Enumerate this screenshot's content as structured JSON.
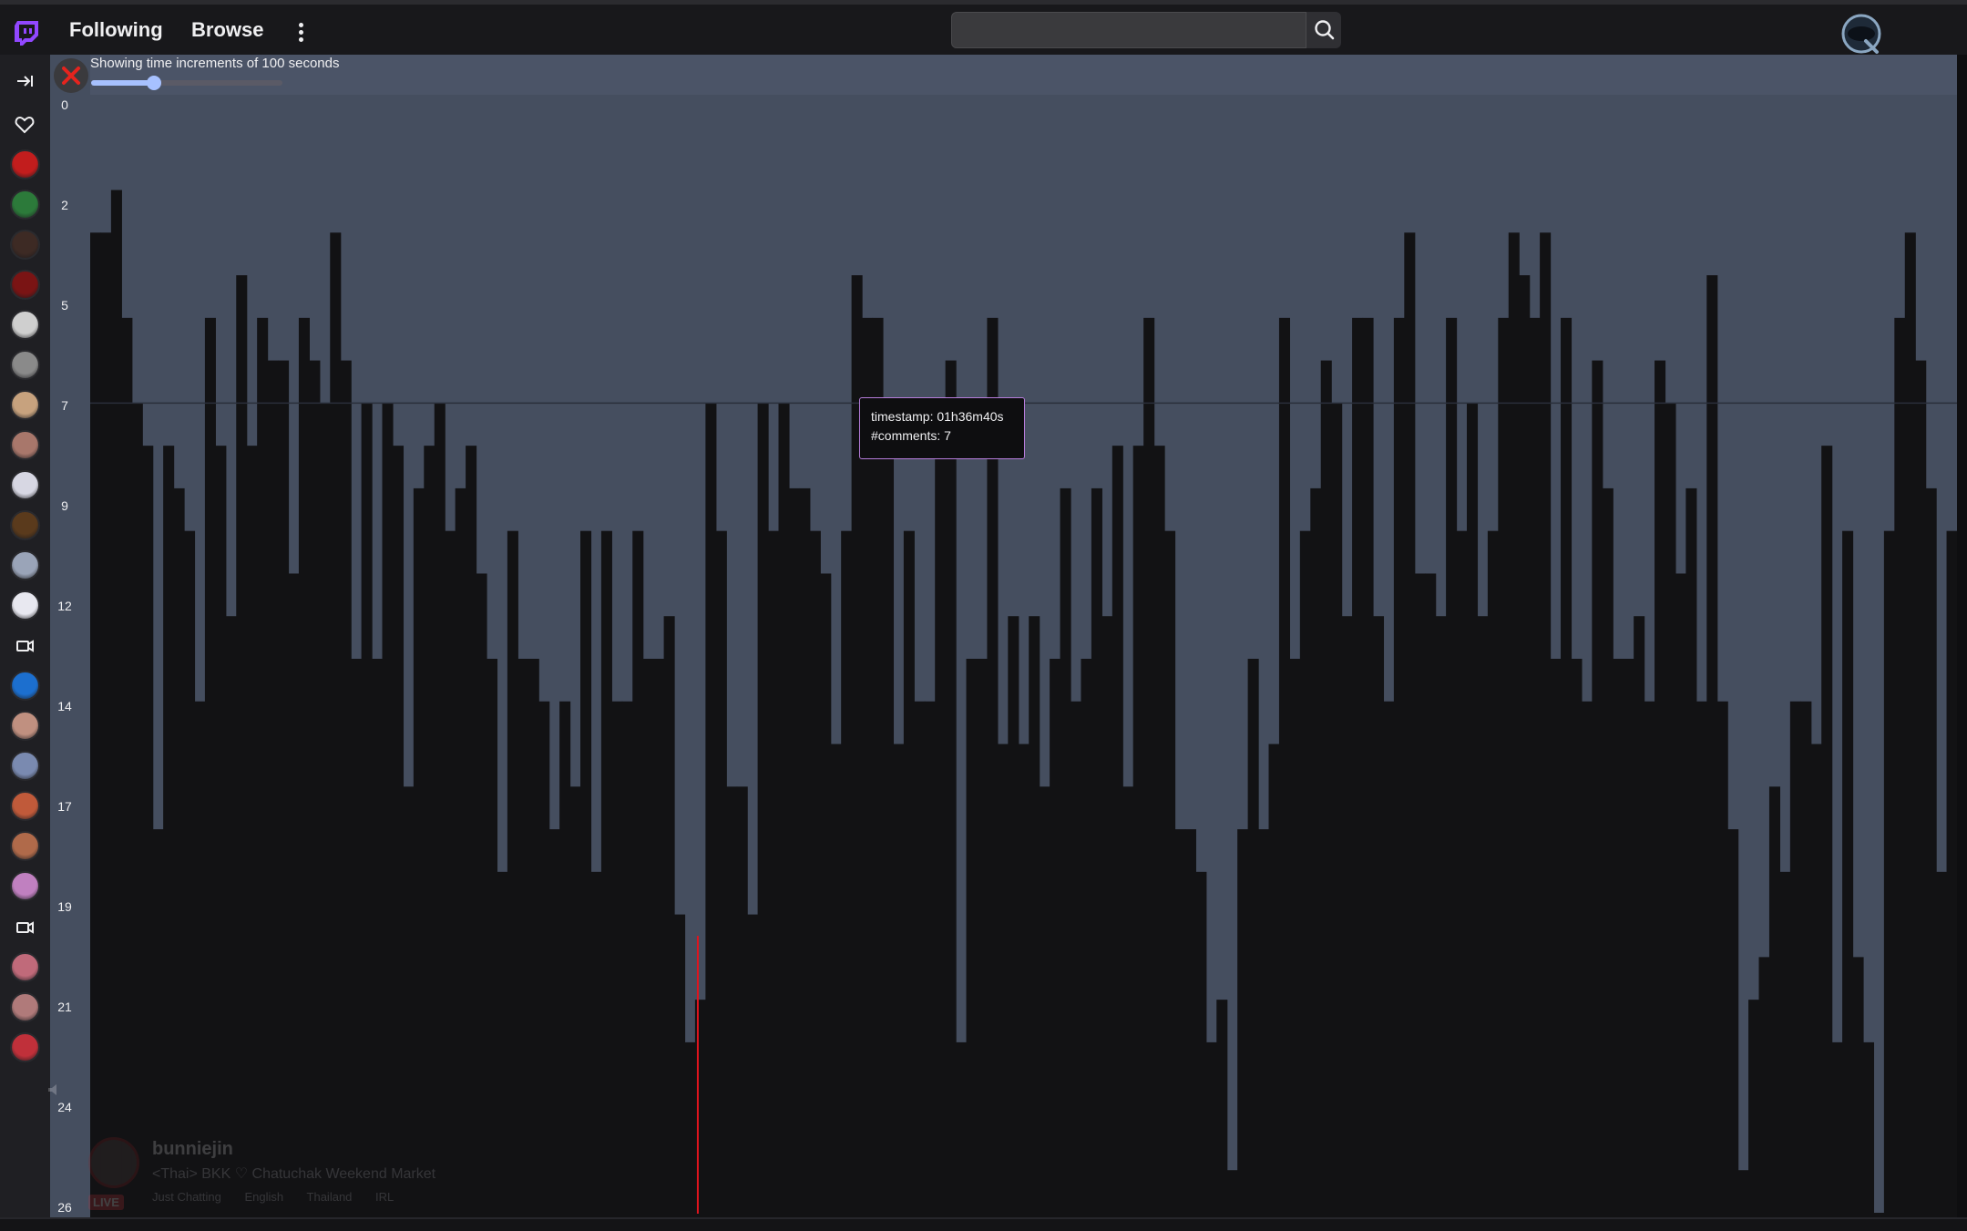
{
  "app": {
    "nav": {
      "following": "Following",
      "browse": "Browse"
    },
    "search": {
      "placeholder": "Search"
    },
    "icons": {
      "logo": "twitch-logo-icon",
      "menu": "more-vertical-icon",
      "search": "search-icon",
      "user": "extension-logo-icon",
      "collapse": "collapse-sidebar-icon",
      "heart": "heart-icon",
      "camera": "video-camera-icon",
      "close": "close-icon",
      "volume": "volume-icon"
    },
    "colors": {
      "accent": "#9147ff",
      "background": "#0e0e10",
      "topbar": "#18181b",
      "sidebar": "#1f1f23",
      "chart_bg": "#454e5f",
      "bar": "#121214",
      "marker": "#e0141e",
      "tooltip_border": "#b57bd9",
      "slider": "#a7c1ff"
    }
  },
  "sidebar": {
    "avatars": [
      "#c21d1d",
      "#2c7a3a",
      "#3d2a24",
      "#7a1414",
      "#cfcfcf",
      "#8a8a8a",
      "#c7a27e",
      "#a8776b",
      "#d7d7e3",
      "#5a3a1c",
      "#9aa4b8",
      "#e8e8f0",
      "#1c6fcf",
      "#c09080",
      "#7a8ab0",
      "#c05a3a",
      "#b06a4a",
      "#c080c0",
      "#c06a7a",
      "#b07a7a",
      "#c0303a"
    ],
    "avatar_colors": [
      "#c21d1d",
      "#2c7a3a",
      "#3d2a24",
      "#7a1414",
      "#cfcfcf",
      "#8a8a8a",
      "#c7a27e",
      "#a8776b",
      "#d7d7e3",
      "#5a3a1c",
      "#9aa4b8",
      "#e8e8f0",
      "#1c6fcf",
      "#c09080",
      "#7a8ab0",
      "#c05a3a",
      "#b06a4a",
      "#c080c0",
      "#c06a7a",
      "#b07a7a",
      "#c0303a"
    ]
  },
  "slider": {
    "label": "Showing time increments of 100 seconds",
    "value_fraction": 0.33
  },
  "tooltip": {
    "timestamp": "timestamp: 01h36m40s",
    "comments": "#comments: 7"
  },
  "stream_info": {
    "name": "bunniejin",
    "title": "<Thai> BKK ♡ Chatuchak Weekend Market",
    "tags": [
      "Just Chatting",
      "English",
      "Thailand",
      "IRL"
    ],
    "live": "LIVE"
  },
  "chart_data": {
    "type": "bar",
    "orientation": "vertical, bars hanging from top, y axis increases downward",
    "x_unit_seconds": 100,
    "yticks": [
      "0",
      "2",
      "5",
      "7",
      "9",
      "12",
      "14",
      "17",
      "19",
      "21",
      "24",
      "26"
    ],
    "ylim": [
      0,
      26
    ],
    "reference_line": 7,
    "highlight_index": 58,
    "values": [
      3,
      3,
      2,
      5,
      7,
      8,
      17,
      8,
      9,
      10,
      14,
      5,
      8,
      12,
      4,
      8,
      5,
      6,
      6,
      11,
      5,
      6,
      7,
      3,
      6,
      13,
      7,
      13,
      7,
      8,
      16,
      9,
      8,
      7,
      10,
      9,
      8,
      11,
      13,
      18,
      10,
      13,
      13,
      14,
      17,
      14,
      16,
      10,
      18,
      10,
      14,
      14,
      10,
      13,
      13,
      12,
      19,
      22,
      21,
      7,
      10,
      16,
      16,
      19,
      7,
      10,
      7,
      9,
      9,
      10,
      11,
      15,
      10,
      4,
      5,
      5,
      7,
      15,
      10,
      14,
      14,
      8,
      6,
      22,
      13,
      13,
      5,
      15,
      12,
      15,
      12,
      16,
      13,
      9,
      14,
      13,
      9,
      12,
      8,
      16,
      8,
      5,
      8,
      10,
      17,
      17,
      18,
      22,
      21,
      25,
      17,
      13,
      17,
      15,
      5,
      13,
      10,
      9,
      6,
      7,
      12,
      5,
      5,
      12,
      14,
      5,
      3,
      11,
      11,
      12,
      5,
      10,
      7,
      12,
      10,
      5,
      3,
      4,
      5,
      3,
      13,
      5,
      13,
      14,
      6,
      9,
      13,
      13,
      12,
      14,
      6,
      7,
      11,
      9,
      14,
      4,
      14,
      17,
      25,
      21,
      20,
      16,
      18,
      14,
      14,
      15,
      8,
      22,
      10,
      20,
      22,
      26,
      10,
      5,
      3,
      6,
      9,
      18,
      10
    ]
  }
}
